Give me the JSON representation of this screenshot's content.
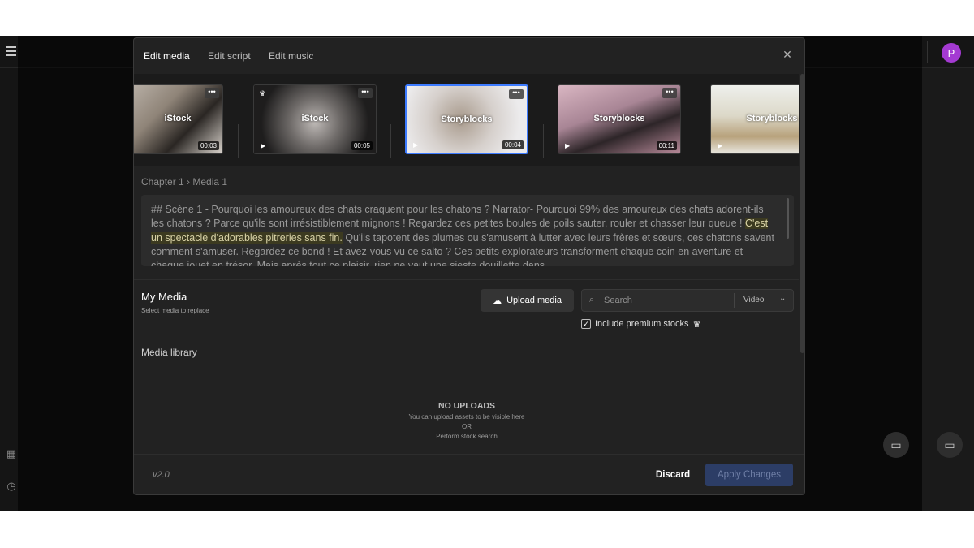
{
  "app": {
    "avatar_letter": "P",
    "accent": "#3d7bff",
    "avatar_color": "#a43ad2"
  },
  "icons": {
    "menu": "hamburger-icon",
    "grid": "grid-icon",
    "history": "clock-icon",
    "chat": "chat-bubble-icon",
    "close": "close-icon"
  },
  "modal": {
    "tabs": [
      {
        "label": "Edit media",
        "active": true
      },
      {
        "label": "Edit script",
        "active": false
      },
      {
        "label": "Edit music",
        "active": false
      }
    ],
    "thumbnails": [
      {
        "source": "iStock",
        "duration": "00:03",
        "selected": false,
        "premium": false
      },
      {
        "source": "iStock",
        "duration": "00:05",
        "selected": false,
        "premium": true
      },
      {
        "source": "Storyblocks",
        "duration": "00:04",
        "selected": true,
        "premium": false
      },
      {
        "source": "Storyblocks",
        "duration": "00:11",
        "selected": false,
        "premium": false
      },
      {
        "source": "Storyblocks",
        "duration": "",
        "selected": false,
        "premium": false
      }
    ],
    "breadcrumb": "Chapter 1 › Media 1",
    "script": {
      "before": "## Scène 1 - Pourquoi les amoureux des chats craquent pour les chatons ? Narrator- Pourquoi 99% des amoureux des chats adorent-ils les chatons ? Parce qu'ils sont irrésistiblement mignons ! Regardez ces petites boules de poils sauter, rouler et chasser leur queue ! ",
      "highlight": "C'est un spectacle d'adorables pitreries sans fin.",
      "after": " Qu'ils tapotent des plumes ou s'amusent à lutter avec leurs frères et sœurs, ces chatons savent comment s'amuser. Regardez ce bond ! Et avez-vous vu ce salto ? Ces petits explorateurs transforment chaque coin en aventure et chaque jouet en trésor. Mais après tout ce plaisir, rien ne vaut une sieste douillette dans"
    },
    "my_media": {
      "title": "My Media",
      "subtitle": "Select media to replace",
      "upload_label": "Upload media",
      "search_placeholder": "Search",
      "search_type": "Video",
      "premium_label": "Include premium stocks",
      "premium_checked": true
    },
    "library": {
      "title": "Media library",
      "empty_title": "NO UPLOADS",
      "empty_line1": "You can upload assets to be visible here",
      "empty_or": "OR",
      "empty_line2": "Perform stock search"
    },
    "footer": {
      "version": "v2.0",
      "discard": "Discard",
      "apply": "Apply Changes"
    }
  }
}
